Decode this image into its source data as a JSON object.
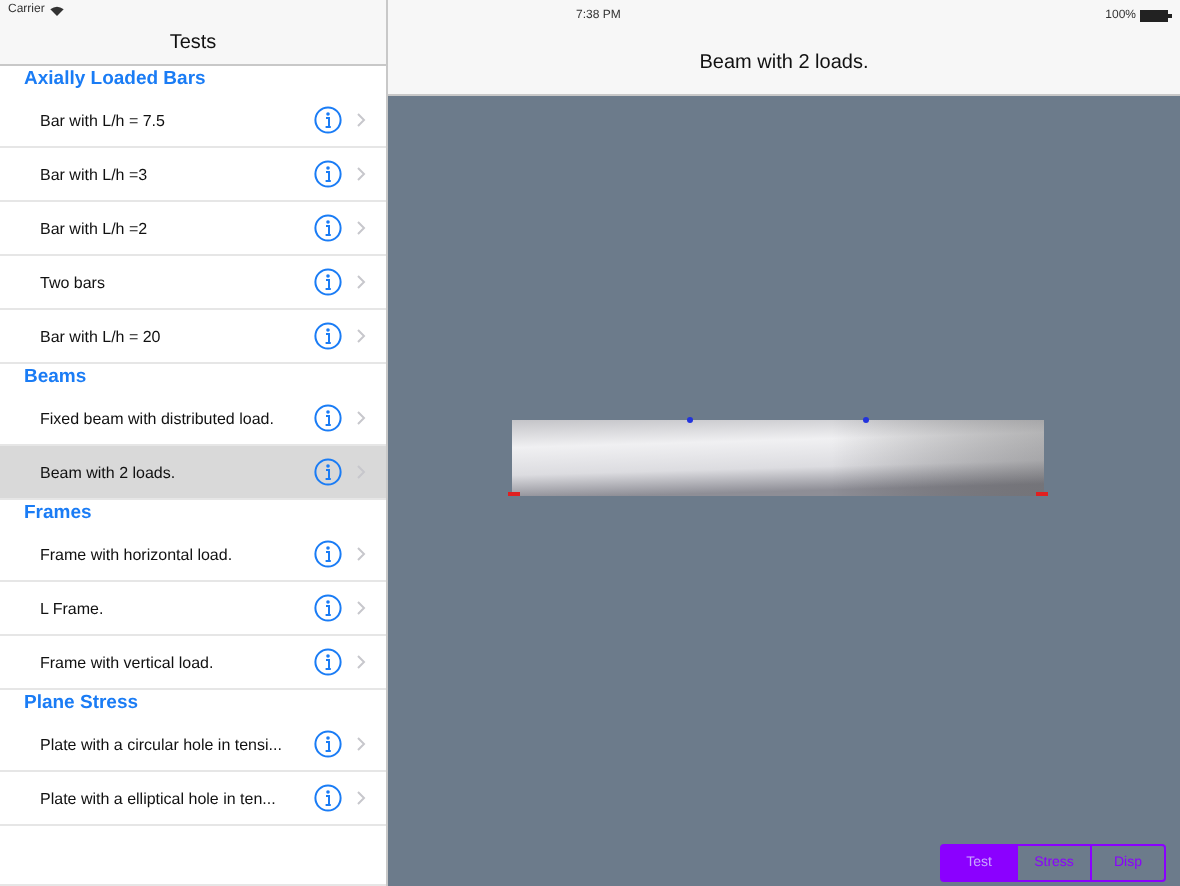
{
  "status_bar": {
    "carrier": "Carrier",
    "time": "7:38 PM",
    "battery": "100%"
  },
  "sidebar": {
    "title": "Tests",
    "sections": [
      {
        "header": "Axially Loaded Bars",
        "items": [
          {
            "label": "Bar with L/h = 7.5",
            "selected": false
          },
          {
            "label": "Bar with L/h =3",
            "selected": false
          },
          {
            "label": "Bar with L/h =2",
            "selected": false
          },
          {
            "label": "Two bars",
            "selected": false
          },
          {
            "label": "Bar with L/h = 20",
            "selected": false
          }
        ]
      },
      {
        "header": "Beams",
        "items": [
          {
            "label": "Fixed beam with distributed load.",
            "selected": false
          },
          {
            "label": "Beam with 2 loads.",
            "selected": true
          }
        ]
      },
      {
        "header": "Frames",
        "items": [
          {
            "label": "Frame with horizontal load.",
            "selected": false
          },
          {
            "label": "L Frame.",
            "selected": false
          },
          {
            "label": "Frame with vertical load.",
            "selected": false
          }
        ]
      },
      {
        "header": "Plane Stress",
        "items": [
          {
            "label": "Plate with a circular hole in tensi...",
            "selected": false
          },
          {
            "label": "Plate with a elliptical hole in ten...",
            "selected": false
          }
        ]
      }
    ]
  },
  "detail": {
    "title": "Beam with 2 loads.",
    "segments": [
      {
        "label": "Test",
        "selected": true
      },
      {
        "label": "Stress",
        "selected": false
      },
      {
        "label": "Disp",
        "selected": false
      }
    ]
  }
}
